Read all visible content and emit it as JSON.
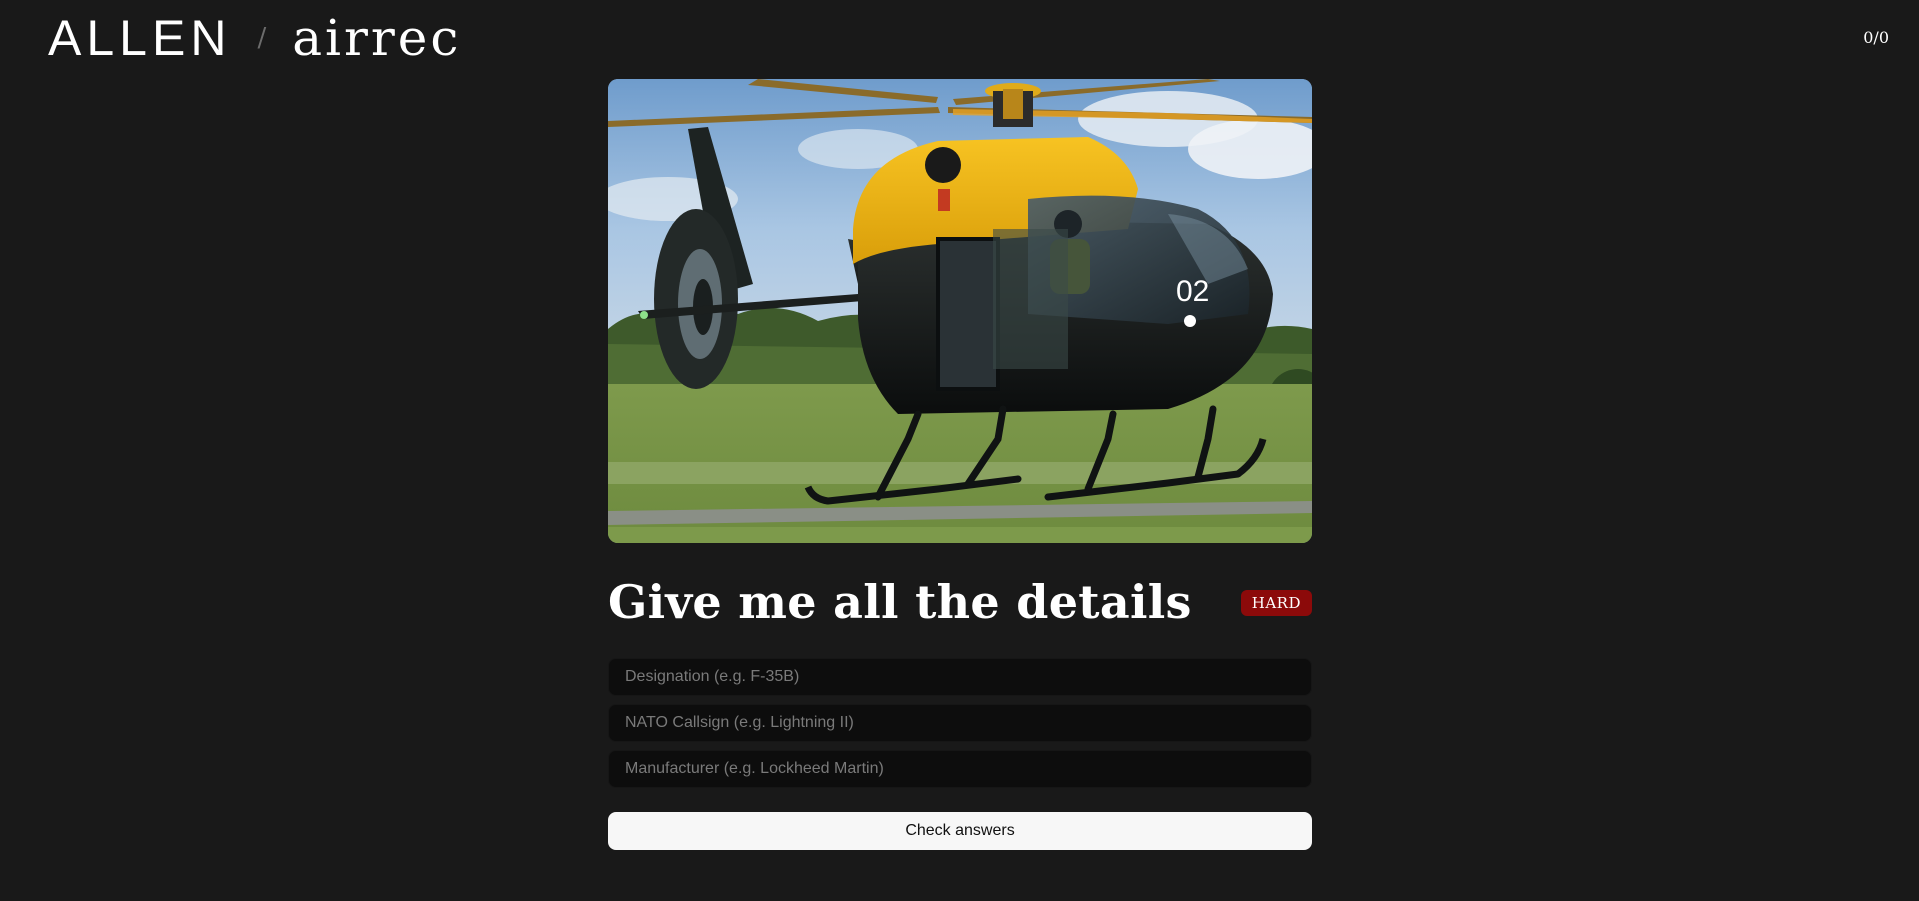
{
  "header": {
    "brand_primary": "ALLEN",
    "brand_separator": "/",
    "brand_app": "airrec",
    "score": "0/0"
  },
  "quiz": {
    "image_icon": "aircraft-photo",
    "title": "Give me all the details",
    "difficulty": "HARD",
    "difficulty_color": "#8c0a0a",
    "fields": {
      "designation_placeholder": "Designation (e.g. F-35B)",
      "designation_value": "",
      "callsign_placeholder": "NATO Callsign (e.g. Lightning II)",
      "callsign_value": "",
      "manufacturer_placeholder": "Manufacturer (e.g. Lockheed Martin)",
      "manufacturer_value": ""
    },
    "submit_label": "Check answers",
    "tail_number": "02"
  }
}
